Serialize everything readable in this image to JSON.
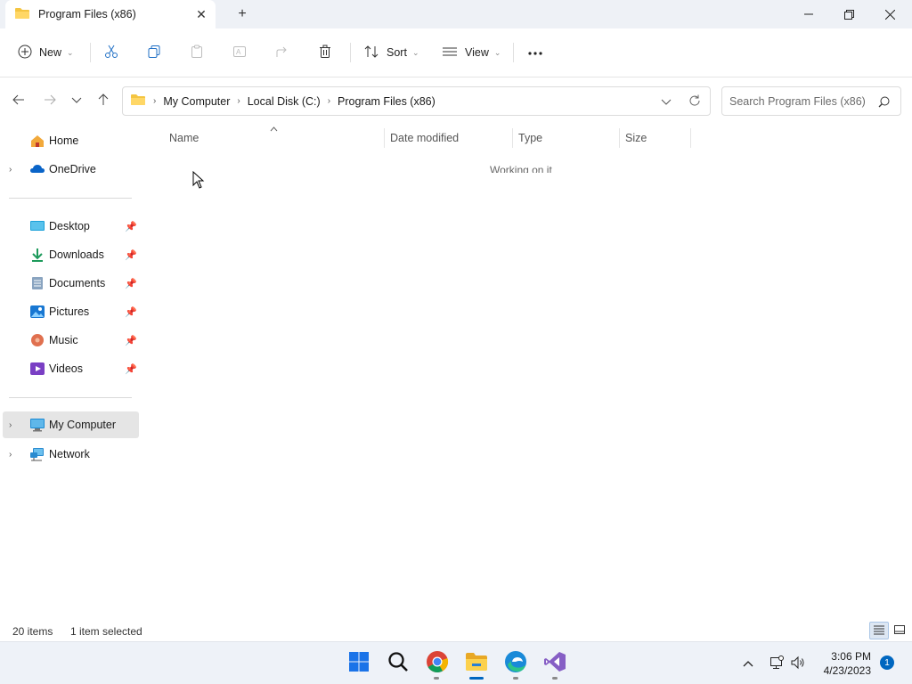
{
  "window": {
    "tab_title": "Program Files (x86)",
    "tab_icon": "folder-icon",
    "minimize_label": "—",
    "maximize_label": "☐",
    "close_label": "✕"
  },
  "commandbar": {
    "new_label": "New",
    "sort_label": "Sort",
    "view_label": "View",
    "more_label": "···"
  },
  "address": {
    "breadcrumbs": [
      "My Computer",
      "Local Disk (C:)",
      "Program Files (x86)"
    ],
    "search_placeholder": "Search Program Files (x86)"
  },
  "sidebar": {
    "items": [
      {
        "label": "Home",
        "icon": "home-icon",
        "expandable": false
      },
      {
        "label": "OneDrive",
        "icon": "onedrive-icon",
        "expandable": true
      },
      {
        "label": "Desktop",
        "icon": "desktop-icon",
        "pinned": true
      },
      {
        "label": "Downloads",
        "icon": "downloads-icon",
        "pinned": true
      },
      {
        "label": "Documents",
        "icon": "documents-icon",
        "pinned": true
      },
      {
        "label": "Pictures",
        "icon": "pictures-icon",
        "pinned": true
      },
      {
        "label": "Music",
        "icon": "music-icon",
        "pinned": true
      },
      {
        "label": "Videos",
        "icon": "videos-icon",
        "pinned": true
      },
      {
        "label": "My Computer",
        "icon": "computer-icon",
        "expandable": true,
        "selected": true
      },
      {
        "label": "Network",
        "icon": "network-icon",
        "expandable": true
      }
    ]
  },
  "content": {
    "columns": [
      "Name",
      "Date modified",
      "Type",
      "Size"
    ],
    "sort_column": "Name",
    "loading_text": "Working on it"
  },
  "status": {
    "item_count": "20 items",
    "selection": "1 item selected"
  },
  "taskbar": {
    "apps": [
      "start-icon",
      "search-icon",
      "chrome-icon",
      "file-explorer-icon",
      "edge-icon",
      "visual-studio-icon"
    ],
    "time": "3:06 PM",
    "date": "4/23/2023",
    "notification_count": "1"
  },
  "colors": {
    "accent": "#0067c0",
    "folder_yellow": "#f4c542",
    "selected_bg": "#e5e5e5"
  }
}
